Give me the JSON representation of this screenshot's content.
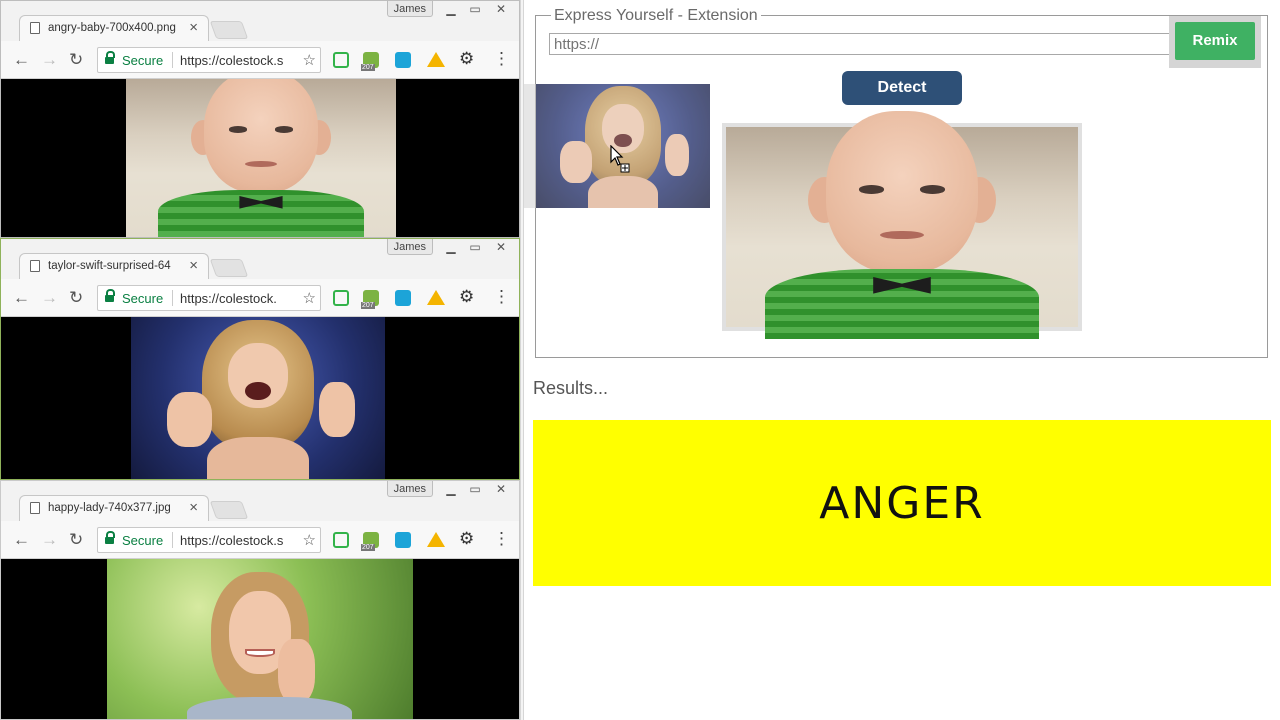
{
  "windows": [
    {
      "tab_title": "angry-baby-700x400.png",
      "user": "James",
      "secure_label": "Secure",
      "url": "https://colestock.s",
      "ext_badge": "207"
    },
    {
      "tab_title": "taylor-swift-surprised-64",
      "user": "James",
      "secure_label": "Secure",
      "url": "https://colestock.",
      "ext_badge": "207"
    },
    {
      "tab_title": "happy-lady-740x377.jpg",
      "user": "James",
      "secure_label": "Secure",
      "url": "https://colestock.s",
      "ext_badge": "207"
    }
  ],
  "extension": {
    "legend": "Express Yourself - Extension",
    "url_placeholder": "https://",
    "detect_label": "Detect",
    "remix_label": "Remix",
    "results_label": "Results...",
    "result_value": "ANGER",
    "result_bg": "#ffff00",
    "detect_color": "#2e5077",
    "remix_color": "#3fb163"
  },
  "icons": {
    "back": "arrow-left",
    "forward": "arrow-right",
    "reload": "reload",
    "star": "star",
    "menu": "vertical-dots",
    "settings": "gear",
    "close": "x"
  }
}
